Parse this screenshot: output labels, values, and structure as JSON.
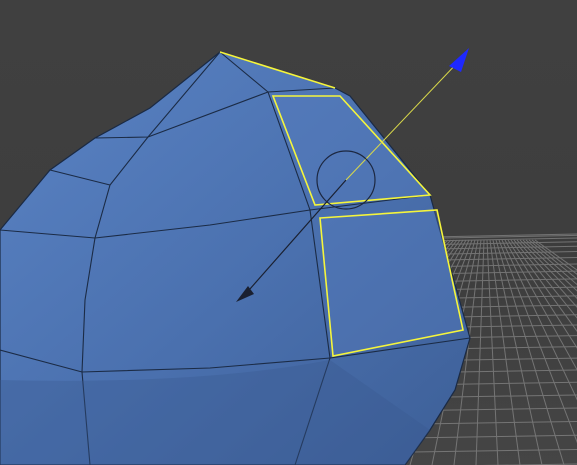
{
  "viewport": {
    "kind": "3d-modeling-viewport",
    "background_color": "#3e3e3e",
    "mesh_color": "#4a6fae",
    "selection_color": "#f5f53c",
    "gizmo_axis_color": "#1e28ff",
    "grid_color": "#8a8a8a",
    "selected_faces": 2
  }
}
